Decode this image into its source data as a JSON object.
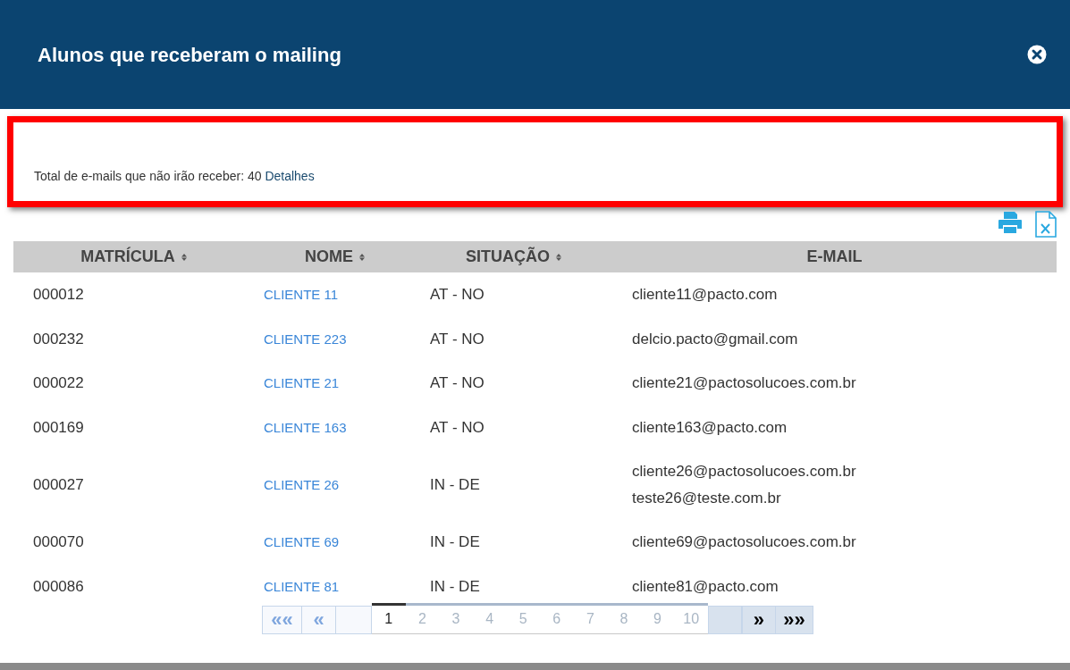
{
  "dialog": {
    "title": "Alunos que receberam o mailing"
  },
  "notice": {
    "text": "Total de e-mails que não irão receber: 40",
    "link": "Detalhes"
  },
  "table": {
    "columns": [
      {
        "label": "MATRÍCULA",
        "sortable": true
      },
      {
        "label": "NOME",
        "sortable": true
      },
      {
        "label": "SITUAÇÃO",
        "sortable": true
      },
      {
        "label": "E-MAIL",
        "sortable": false
      }
    ],
    "rows": [
      {
        "matricula": "000012",
        "nome": "CLIENTE 11",
        "situacao": "AT - NO",
        "emails": [
          "cliente11@pacto.com"
        ]
      },
      {
        "matricula": "000232",
        "nome": "CLIENTE 223",
        "situacao": "AT - NO",
        "emails": [
          "delcio.pacto@gmail.com"
        ]
      },
      {
        "matricula": "000022",
        "nome": "CLIENTE 21",
        "situacao": "AT - NO",
        "emails": [
          "cliente21@pactosolucoes.com.br"
        ]
      },
      {
        "matricula": "000169",
        "nome": "CLIENTE 163",
        "situacao": "AT - NO",
        "emails": [
          "cliente163@pacto.com"
        ]
      },
      {
        "matricula": "000027",
        "nome": "CLIENTE 26",
        "situacao": "IN - DE",
        "emails": [
          "cliente26@pactosolucoes.com.br",
          "teste26@teste.com.br"
        ]
      },
      {
        "matricula": "000070",
        "nome": "CLIENTE 69",
        "situacao": "IN - DE",
        "emails": [
          "cliente69@pactosolucoes.com.br"
        ]
      },
      {
        "matricula": "000086",
        "nome": "CLIENTE 81",
        "situacao": "IN - DE",
        "emails": [
          "cliente81@pacto.com"
        ]
      }
    ]
  },
  "pagination": {
    "first": {
      "label": "««",
      "disabled": true
    },
    "prev": {
      "label": "«",
      "disabled": true
    },
    "pages": [
      {
        "label": "1",
        "selected": true
      },
      {
        "label": "2",
        "selected": false
      },
      {
        "label": "3",
        "selected": false
      },
      {
        "label": "4",
        "selected": false
      },
      {
        "label": "5",
        "selected": false
      },
      {
        "label": "6",
        "selected": false
      },
      {
        "label": "7",
        "selected": false
      },
      {
        "label": "8",
        "selected": false
      },
      {
        "label": "9",
        "selected": false
      },
      {
        "label": "10",
        "selected": false
      }
    ],
    "next": {
      "label": "»",
      "disabled": false
    },
    "last": {
      "label": "»»",
      "disabled": false
    }
  }
}
